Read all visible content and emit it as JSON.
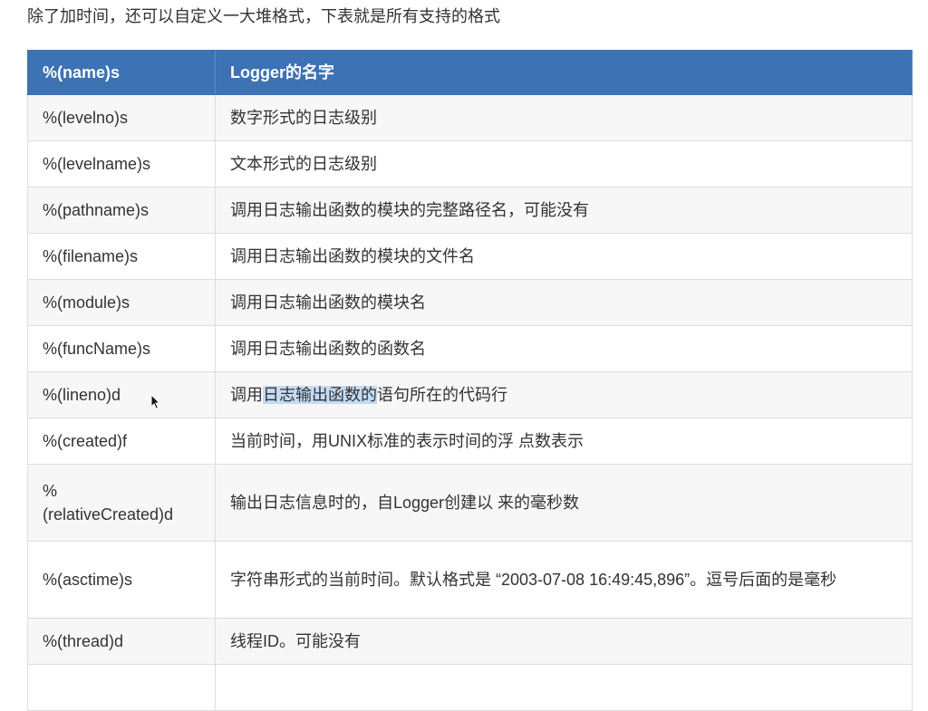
{
  "intro": "除了加时间，还可以自定义一大堆格式，下表就是所有支持的格式",
  "colors": {
    "header_bg": "#3d72b4",
    "header_text": "#ffffff",
    "row_alt": "#f7f7f7",
    "border": "#dddddd",
    "selection": "#c5daf5"
  },
  "table": {
    "headers": [
      "%(name)s",
      "Logger的名字"
    ],
    "rows": [
      {
        "key": "%(levelno)s",
        "desc": "数字形式的日志级别"
      },
      {
        "key": "%(levelname)s",
        "desc": "文本形式的日志级别"
      },
      {
        "key": "%(pathname)s",
        "desc": "调用日志输出函数的模块的完整路径名，可能没有"
      },
      {
        "key": "%(filename)s",
        "desc": "调用日志输出函数的模块的文件名"
      },
      {
        "key": "%(module)s",
        "desc": "调用日志输出函数的模块名"
      },
      {
        "key": "%(funcName)s",
        "desc": "调用日志输出函数的函数名"
      },
      {
        "key": "%(lineno)d",
        "desc_before": "调用",
        "desc_selected": "日志输出函数的",
        "desc_after": "语句所在的代码行"
      },
      {
        "key": "%(created)f",
        "desc": "当前时间，用UNIX标准的表示时间的浮 点数表示"
      },
      {
        "key_line1": "%",
        "key_line2": "(relativeCreated)d",
        "desc": "输出日志信息时的，自Logger创建以 来的毫秒数"
      },
      {
        "key": "%(asctime)s",
        "desc": "字符串形式的当前时间。默认格式是 “2003-07-08 16:49:45,896”。逗号后面的是毫秒"
      },
      {
        "key": "%(thread)d",
        "desc": "线程ID。可能没有"
      },
      {
        "key": "",
        "desc": ""
      }
    ]
  },
  "cursor_icon": "mouse-pointer-icon"
}
